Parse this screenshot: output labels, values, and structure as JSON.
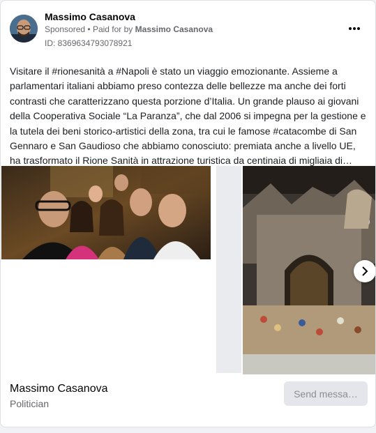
{
  "header": {
    "name": "Massimo Casanova",
    "sponsored": "Sponsored",
    "paid_for_prefix": "Paid for by",
    "paid_for_name": "Massimo Casanova",
    "id_text": "ID: 8369634793078921"
  },
  "post": {
    "text": "Visitare il #rionesanità a #Napoli è stato un viaggio emozionante. Assieme a parlamentari italiani abbiamo preso contezza delle bellezze ma anche dei forti contrasti che caratterizzano questa porzione d’Italia. Un grande plauso ai giovani della Cooperativa Sociale “La Paranza”, che dal 2006 si impegna per la gestione e la tutela dei beni storico-artistici della zona, tra cui le famose #catacombe di San Gennaro e San Gaudioso che abbiamo conosciuto: premiata anche a livello UE, ha trasformato il Rione Sanità in attrazione turistica da centinaia di migliaia di…"
  },
  "footer": {
    "name": "Massimo Casanova",
    "subtitle": "Politician",
    "send_label": "Send messa…"
  },
  "icons": {
    "more": "more-options-icon",
    "next": "chevron-right-icon"
  }
}
